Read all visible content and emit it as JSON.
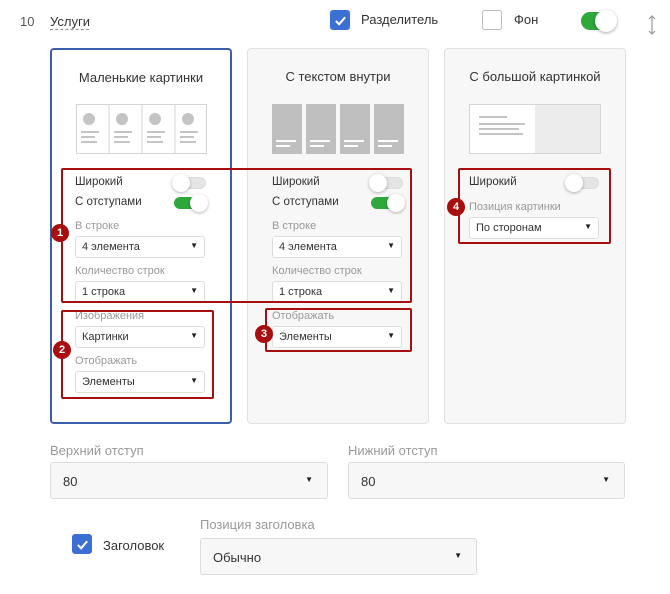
{
  "header": {
    "index": "10",
    "title": "Услуги",
    "divider_label": "Разделитель",
    "background_label": "Фон"
  },
  "cards": [
    {
      "title": "Маленькие картинки",
      "wide_label": "Широкий",
      "gaps_label": "С отступами",
      "row_label": "В строке",
      "row_value": "4 элемента",
      "rows_count_label": "Количество строк",
      "rows_count_value": "1 строка",
      "images_label": "Изображения",
      "images_value": "Картинки",
      "display_label": "Отображать",
      "display_value": "Элементы"
    },
    {
      "title": "С текстом внутри",
      "wide_label": "Широкий",
      "gaps_label": "С отступами",
      "row_label": "В строке",
      "row_value": "4 элемента",
      "rows_count_label": "Количество строк",
      "rows_count_value": "1 строка",
      "display_label": "Отображать",
      "display_value": "Элементы"
    },
    {
      "title": "С большой картинкой",
      "wide_label": "Широкий",
      "image_position_label": "Позиция картинки",
      "image_position_value": "По сторонам"
    }
  ],
  "badges": [
    "1",
    "2",
    "3",
    "4"
  ],
  "padding": {
    "top_label": "Верхний отступ",
    "top_value": "80",
    "bottom_label": "Нижний отступ",
    "bottom_value": "80"
  },
  "heading": {
    "checkbox_label": "Заголовок",
    "position_label": "Позиция заголовка",
    "position_value": "Обычно"
  },
  "colors": {
    "accent_blue": "#3b6fd4",
    "selected_border": "#3a5ea8",
    "annotation_red": "#a80d10",
    "toggle_green": "#2ea83a"
  },
  "icons": [
    "check-icon",
    "chevron-down-icon",
    "resize-vertical-icon"
  ]
}
